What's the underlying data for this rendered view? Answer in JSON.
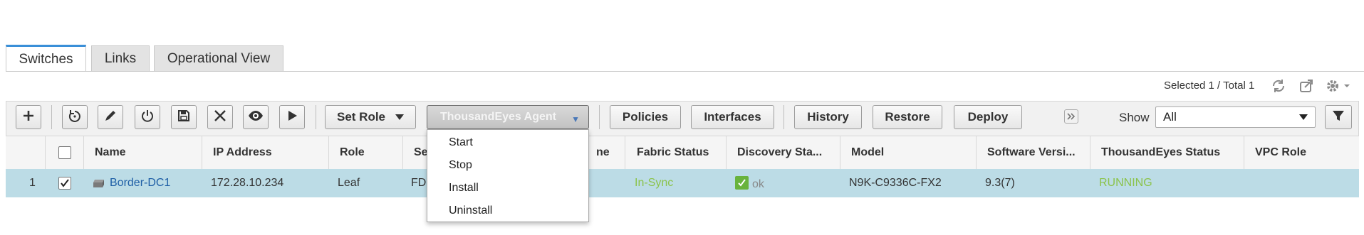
{
  "tabs": [
    "Switches",
    "Links",
    "Operational View"
  ],
  "selection_summary": "Selected 1 / Total 1",
  "toolbar": {
    "set_role_label": "Set Role",
    "agent_dropdown_label": "ThousandEyes Agent",
    "policies_label": "Policies",
    "interfaces_label": "Interfaces",
    "history_label": "History",
    "restore_label": "Restore",
    "deploy_label": "Deploy",
    "show_label": "Show",
    "show_value": "All"
  },
  "agent_menu": [
    "Start",
    "Stop",
    "Install",
    "Uninstall"
  ],
  "table": {
    "columns": [
      "Name",
      "IP Address",
      "Role",
      "Se",
      "ne",
      "Fabric Status",
      "Discovery Sta...",
      "Model",
      "Software Versi...",
      "ThousandEyes Status",
      "VPC Role"
    ],
    "rows": [
      {
        "index": "1",
        "name": "Border-DC1",
        "ip": "172.28.10.234",
        "role": "Leaf",
        "serial_partial": "FD",
        "fabric_status": "In-Sync",
        "discovery_status": "ok",
        "model": "N9K-C9336C-FX2",
        "software_version": "9.3(7)",
        "thousandeyes_status": "RUNNING",
        "vpc_role": ""
      }
    ]
  },
  "colors": {
    "accent_tab": "#3a8fd8",
    "row_selected": "#bcdce6",
    "status_green": "#8bc34a",
    "link": "#1f5fa6"
  },
  "icons": [
    "add-icon",
    "refresh-icon",
    "edit-icon",
    "power-icon",
    "save-icon",
    "delete-icon",
    "view-icon",
    "play-icon",
    "expand-icon",
    "filter-icon",
    "sync-icon",
    "export-icon",
    "gear-icon",
    "switch-device-icon",
    "check-ok-icon"
  ]
}
